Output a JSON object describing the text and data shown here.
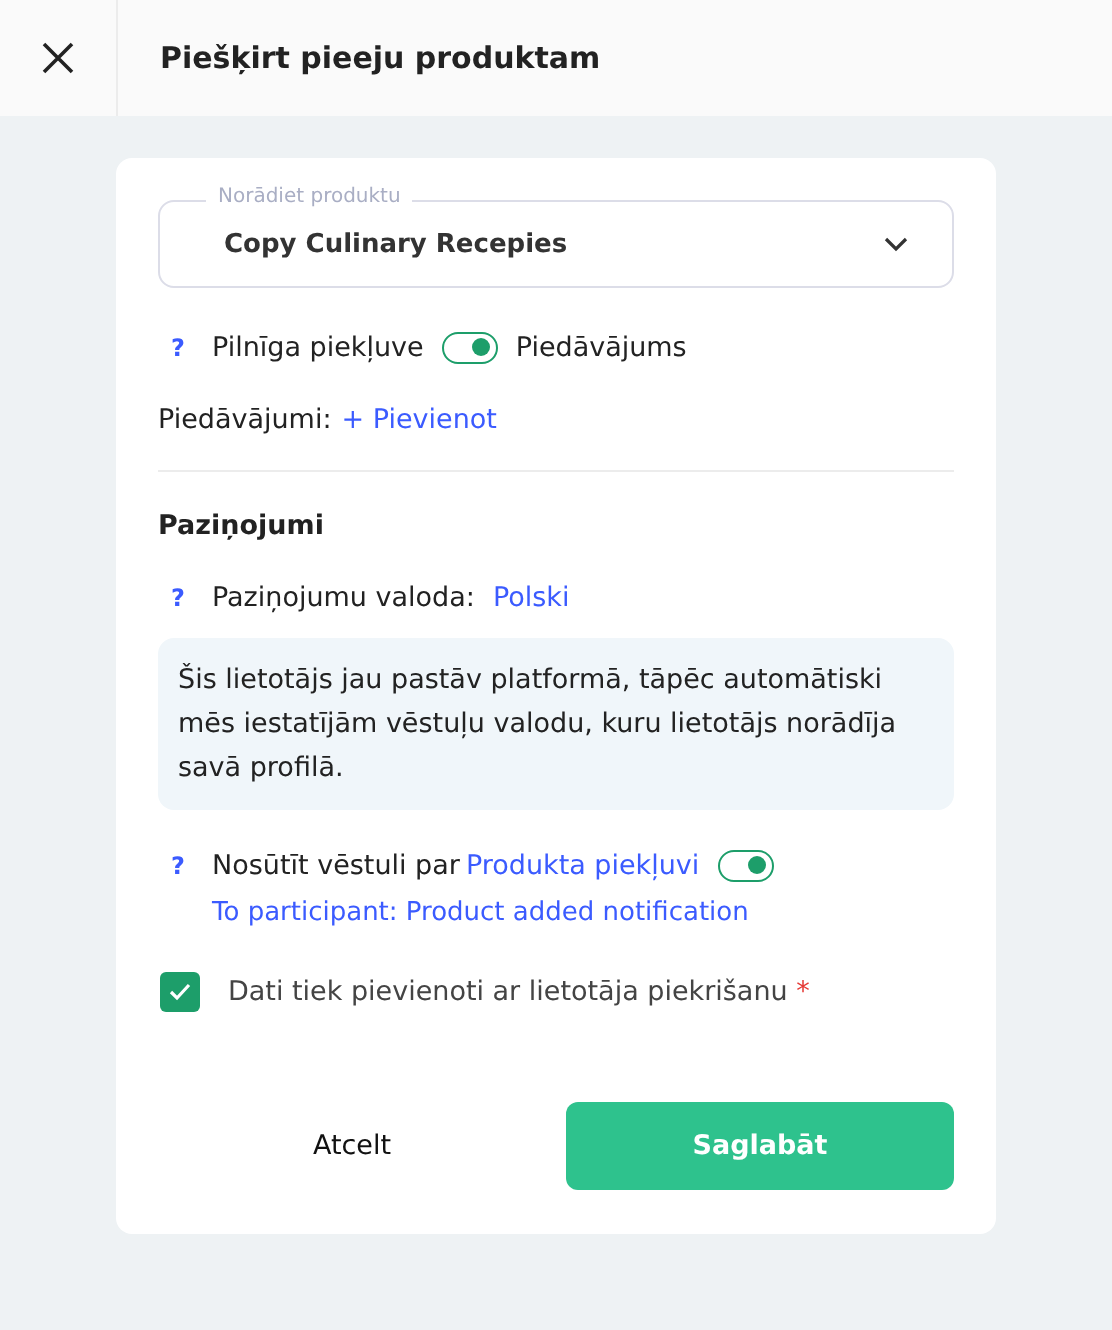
{
  "header": {
    "title": "Piešķirt pieeju produktam"
  },
  "product_select": {
    "label": "Norādiet produktu",
    "value": "Copy Culinary Recepies"
  },
  "access_toggle": {
    "help": "?",
    "left_label": "Pilnīga piekļuve",
    "right_label": "Piedāvājums",
    "on": true
  },
  "offers": {
    "label": "Piedāvājumi:",
    "add_link": "+ Pievienot"
  },
  "notifications": {
    "heading": "Paziņojumi",
    "help": "?",
    "language_label": "Paziņojumu valoda:",
    "language_value": "Polski",
    "info": "Šis lietotājs jau pastāv platformā, tāpēc automātiski mēs iestatījām vēstuļu valodu, kuru lietotājs norādīja savā profilā.",
    "send_help": "?",
    "send_label": "Nosūtīt vēstuli par",
    "send_link": "Produkta piekļuvi",
    "send_on": true,
    "template_link": "To participant: Product added notification"
  },
  "consent": {
    "label": "Dati tiek pievienoti ar lietotāja piekrišanu",
    "required_mark": "*",
    "checked": true
  },
  "buttons": {
    "cancel": "Atcelt",
    "save": "Saglabāt"
  }
}
